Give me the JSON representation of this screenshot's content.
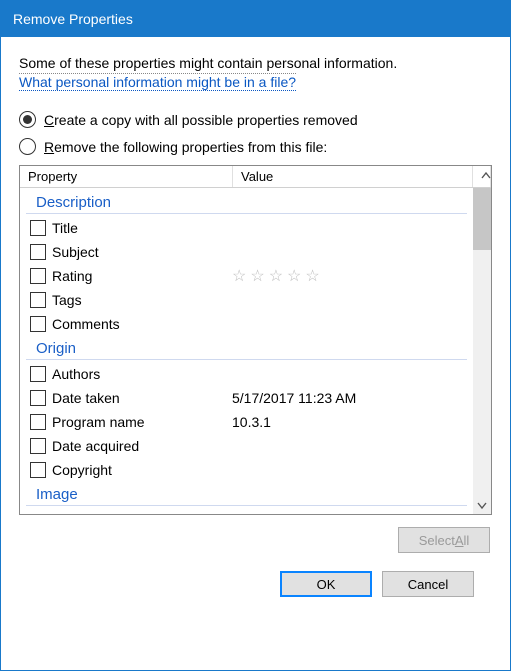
{
  "title": "Remove Properties",
  "intro": "Some of these properties might contain personal information.",
  "link": "What personal information might be in a file?",
  "options": {
    "createCopy": {
      "text": "reate a copy with all possible properties removed",
      "accel": "C",
      "selected": true
    },
    "removeFrom": {
      "text": "emove the following properties from this file:",
      "accel": "R",
      "selected": false
    }
  },
  "columns": {
    "property": "Property",
    "value": "Value"
  },
  "groups": [
    {
      "name": "Description",
      "items": [
        {
          "label": "Title",
          "value": ""
        },
        {
          "label": "Subject",
          "value": ""
        },
        {
          "label": "Rating",
          "value": "stars"
        },
        {
          "label": "Tags",
          "value": ""
        },
        {
          "label": "Comments",
          "value": ""
        }
      ]
    },
    {
      "name": "Origin",
      "items": [
        {
          "label": "Authors",
          "value": ""
        },
        {
          "label": "Date taken",
          "value": "5/17/2017 11:23 AM"
        },
        {
          "label": "Program name",
          "value": "10.3.1"
        },
        {
          "label": "Date acquired",
          "value": ""
        },
        {
          "label": "Copyright",
          "value": ""
        }
      ]
    },
    {
      "name": "Image",
      "items": []
    }
  ],
  "buttons": {
    "selectAll": {
      "text": "ll",
      "prefix": "Select ",
      "accel": "A",
      "enabled": false
    },
    "ok": "OK",
    "cancel": "Cancel"
  }
}
